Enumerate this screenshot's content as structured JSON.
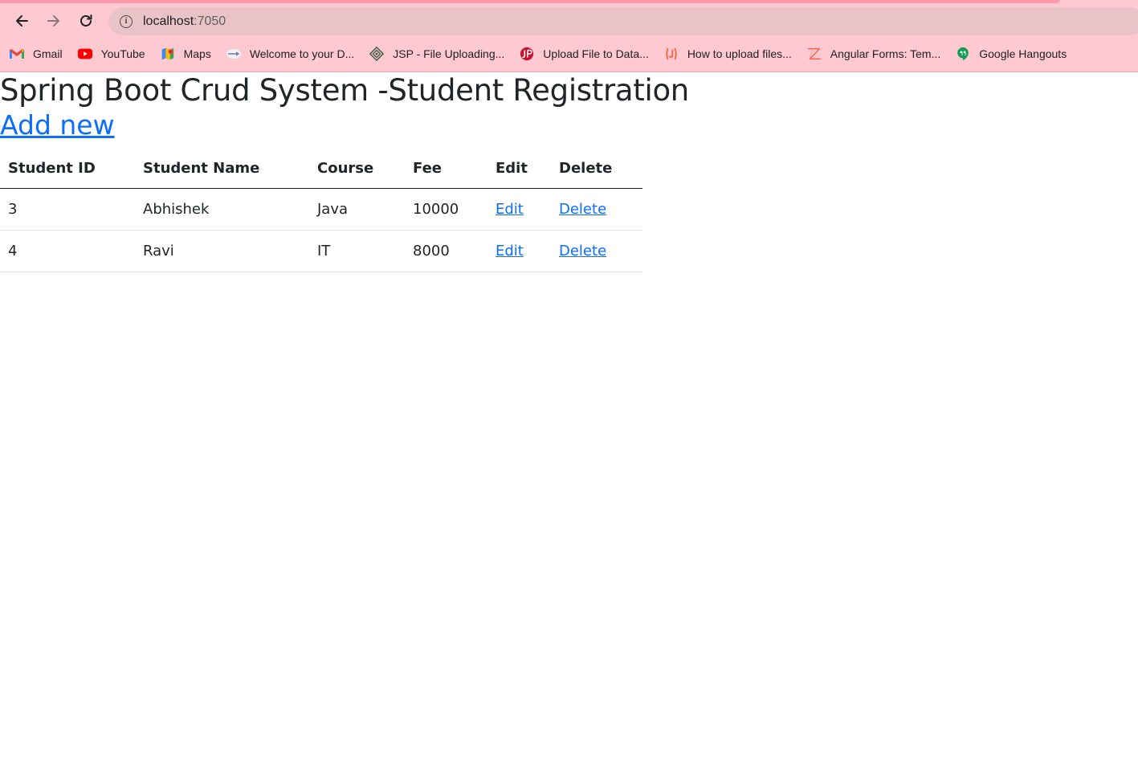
{
  "browser": {
    "url_host": "localhost",
    "url_port": ":7050",
    "bookmarks": [
      {
        "label": "Gmail",
        "icon": "gmail-icon"
      },
      {
        "label": "YouTube",
        "icon": "youtube-icon"
      },
      {
        "label": "Maps",
        "icon": "maps-icon"
      },
      {
        "label": "Welcome to your D...",
        "icon": "site-favicon"
      },
      {
        "label": "JSP - File Uploading...",
        "icon": "tutorialspoint-icon"
      },
      {
        "label": "Upload File to Data...",
        "icon": "javatpoint-icon"
      },
      {
        "label": "How to upload files...",
        "icon": "javaguides-icon"
      },
      {
        "label": "Angular Forms: Tem...",
        "icon": "angular-forms-icon"
      },
      {
        "label": "Google Hangouts",
        "icon": "hangouts-icon"
      }
    ]
  },
  "page": {
    "title": "Spring Boot Crud System -Student Registration",
    "add_link": "Add new"
  },
  "table": {
    "headers": [
      "Student ID",
      "Student Name",
      "Course",
      "Fee",
      "Edit",
      "Delete"
    ],
    "rows": [
      {
        "id": "3",
        "name": "Abhishek",
        "course": "Java",
        "fee": "10000",
        "edit": "Edit",
        "delete": "Delete"
      },
      {
        "id": "4",
        "name": "Ravi",
        "course": "IT",
        "fee": "8000",
        "edit": "Edit",
        "delete": "Delete"
      }
    ]
  },
  "colors": {
    "chrome_bg": "#ffc9d1",
    "link": "#0d6efd",
    "text": "#212529"
  }
}
